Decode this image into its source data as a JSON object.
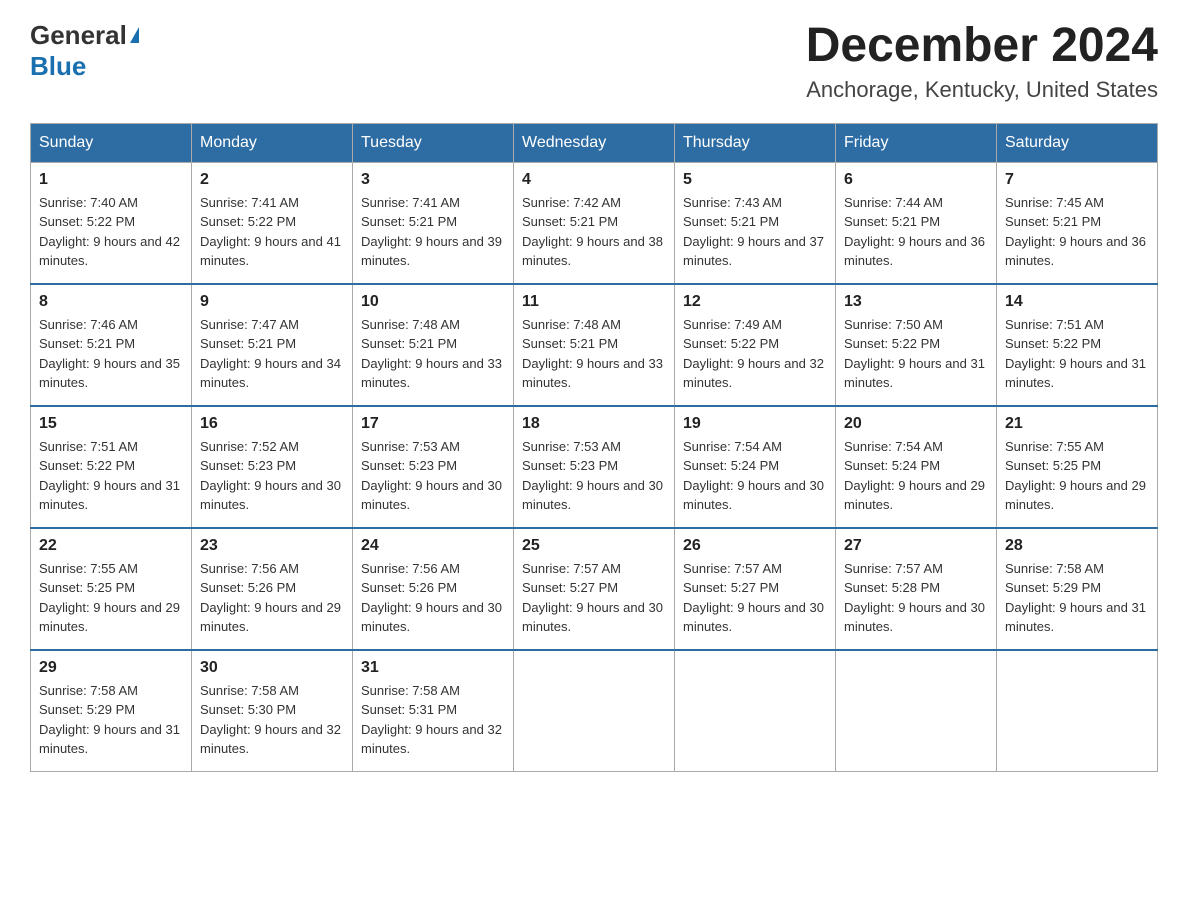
{
  "header": {
    "logo_general": "General",
    "logo_blue": "Blue",
    "title": "December 2024",
    "subtitle": "Anchorage, Kentucky, United States"
  },
  "days_of_week": [
    "Sunday",
    "Monday",
    "Tuesday",
    "Wednesday",
    "Thursday",
    "Friday",
    "Saturday"
  ],
  "weeks": [
    [
      {
        "day": "1",
        "sunrise": "7:40 AM",
        "sunset": "5:22 PM",
        "daylight": "9 hours and 42 minutes."
      },
      {
        "day": "2",
        "sunrise": "7:41 AM",
        "sunset": "5:22 PM",
        "daylight": "9 hours and 41 minutes."
      },
      {
        "day": "3",
        "sunrise": "7:41 AM",
        "sunset": "5:21 PM",
        "daylight": "9 hours and 39 minutes."
      },
      {
        "day": "4",
        "sunrise": "7:42 AM",
        "sunset": "5:21 PM",
        "daylight": "9 hours and 38 minutes."
      },
      {
        "day": "5",
        "sunrise": "7:43 AM",
        "sunset": "5:21 PM",
        "daylight": "9 hours and 37 minutes."
      },
      {
        "day": "6",
        "sunrise": "7:44 AM",
        "sunset": "5:21 PM",
        "daylight": "9 hours and 36 minutes."
      },
      {
        "day": "7",
        "sunrise": "7:45 AM",
        "sunset": "5:21 PM",
        "daylight": "9 hours and 36 minutes."
      }
    ],
    [
      {
        "day": "8",
        "sunrise": "7:46 AM",
        "sunset": "5:21 PM",
        "daylight": "9 hours and 35 minutes."
      },
      {
        "day": "9",
        "sunrise": "7:47 AM",
        "sunset": "5:21 PM",
        "daylight": "9 hours and 34 minutes."
      },
      {
        "day": "10",
        "sunrise": "7:48 AM",
        "sunset": "5:21 PM",
        "daylight": "9 hours and 33 minutes."
      },
      {
        "day": "11",
        "sunrise": "7:48 AM",
        "sunset": "5:21 PM",
        "daylight": "9 hours and 33 minutes."
      },
      {
        "day": "12",
        "sunrise": "7:49 AM",
        "sunset": "5:22 PM",
        "daylight": "9 hours and 32 minutes."
      },
      {
        "day": "13",
        "sunrise": "7:50 AM",
        "sunset": "5:22 PM",
        "daylight": "9 hours and 31 minutes."
      },
      {
        "day": "14",
        "sunrise": "7:51 AM",
        "sunset": "5:22 PM",
        "daylight": "9 hours and 31 minutes."
      }
    ],
    [
      {
        "day": "15",
        "sunrise": "7:51 AM",
        "sunset": "5:22 PM",
        "daylight": "9 hours and 31 minutes."
      },
      {
        "day": "16",
        "sunrise": "7:52 AM",
        "sunset": "5:23 PM",
        "daylight": "9 hours and 30 minutes."
      },
      {
        "day": "17",
        "sunrise": "7:53 AM",
        "sunset": "5:23 PM",
        "daylight": "9 hours and 30 minutes."
      },
      {
        "day": "18",
        "sunrise": "7:53 AM",
        "sunset": "5:23 PM",
        "daylight": "9 hours and 30 minutes."
      },
      {
        "day": "19",
        "sunrise": "7:54 AM",
        "sunset": "5:24 PM",
        "daylight": "9 hours and 30 minutes."
      },
      {
        "day": "20",
        "sunrise": "7:54 AM",
        "sunset": "5:24 PM",
        "daylight": "9 hours and 29 minutes."
      },
      {
        "day": "21",
        "sunrise": "7:55 AM",
        "sunset": "5:25 PM",
        "daylight": "9 hours and 29 minutes."
      }
    ],
    [
      {
        "day": "22",
        "sunrise": "7:55 AM",
        "sunset": "5:25 PM",
        "daylight": "9 hours and 29 minutes."
      },
      {
        "day": "23",
        "sunrise": "7:56 AM",
        "sunset": "5:26 PM",
        "daylight": "9 hours and 29 minutes."
      },
      {
        "day": "24",
        "sunrise": "7:56 AM",
        "sunset": "5:26 PM",
        "daylight": "9 hours and 30 minutes."
      },
      {
        "day": "25",
        "sunrise": "7:57 AM",
        "sunset": "5:27 PM",
        "daylight": "9 hours and 30 minutes."
      },
      {
        "day": "26",
        "sunrise": "7:57 AM",
        "sunset": "5:27 PM",
        "daylight": "9 hours and 30 minutes."
      },
      {
        "day": "27",
        "sunrise": "7:57 AM",
        "sunset": "5:28 PM",
        "daylight": "9 hours and 30 minutes."
      },
      {
        "day": "28",
        "sunrise": "7:58 AM",
        "sunset": "5:29 PM",
        "daylight": "9 hours and 31 minutes."
      }
    ],
    [
      {
        "day": "29",
        "sunrise": "7:58 AM",
        "sunset": "5:29 PM",
        "daylight": "9 hours and 31 minutes."
      },
      {
        "day": "30",
        "sunrise": "7:58 AM",
        "sunset": "5:30 PM",
        "daylight": "9 hours and 32 minutes."
      },
      {
        "day": "31",
        "sunrise": "7:58 AM",
        "sunset": "5:31 PM",
        "daylight": "9 hours and 32 minutes."
      },
      null,
      null,
      null,
      null
    ]
  ]
}
